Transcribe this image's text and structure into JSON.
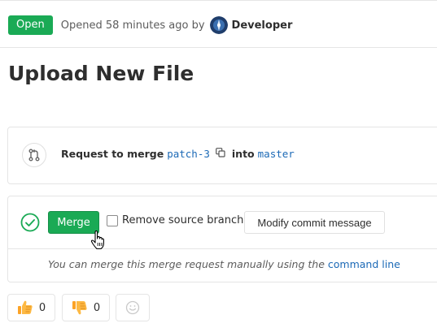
{
  "header": {
    "status_badge": "Open",
    "opened_text": "Opened 58 minutes ago by",
    "author": "Developer"
  },
  "title": "Upload New File",
  "merge_request": {
    "request_label": "Request to merge",
    "source_branch": "patch-3",
    "into_label": "into",
    "target_branch": "master"
  },
  "merge_widget": {
    "merge_button": "Merge",
    "remove_source_label": "Remove source branch",
    "remove_source_checked": false,
    "modify_commit_button": "Modify commit message",
    "hint_text": "You can merge this merge request manually using the",
    "hint_link": "command line"
  },
  "awards": {
    "thumbs_up_count": "0",
    "thumbs_down_count": "0"
  },
  "colors": {
    "success": "#1aaa55",
    "link": "#1b69b6",
    "award_emoji": "#fca326"
  },
  "icons": [
    "avatar",
    "merge-request-icon",
    "copy-icon",
    "check-circle-icon",
    "hand-cursor-icon",
    "thumbs-up-icon",
    "thumbs-down-icon",
    "smiley-icon"
  ]
}
